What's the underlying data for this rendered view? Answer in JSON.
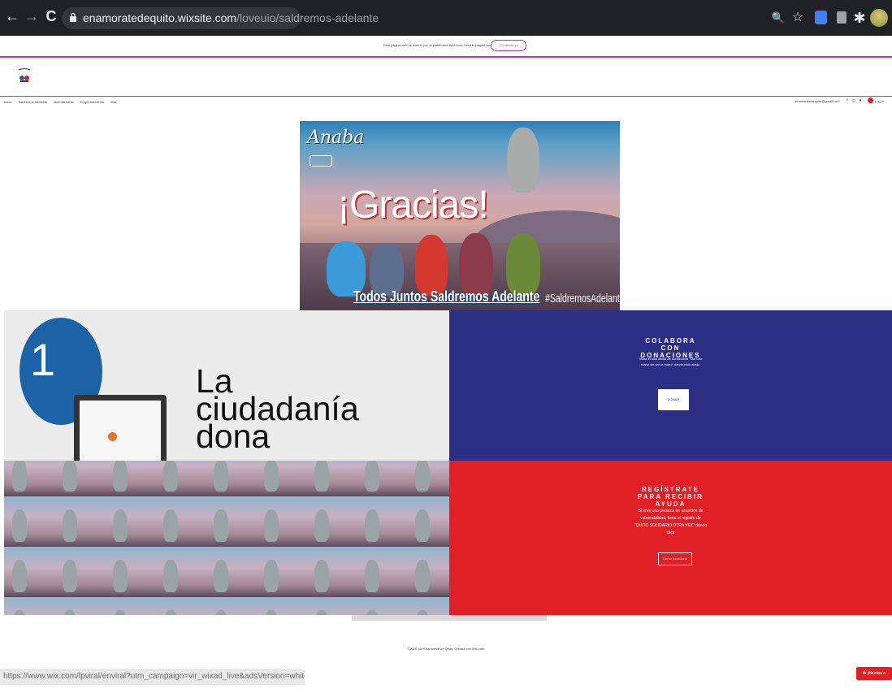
{
  "browser": {
    "url_domain": "enamoratedequito.wixsite.com",
    "url_path": "/loveuio/saldremos-adelante",
    "back_icon": "←",
    "forward_icon": "→",
    "reload_icon": "C",
    "zoom_icon": "🔍",
    "star_icon": "☆",
    "extensions_icon": "✱"
  },
  "wix_banner": {
    "text": "Esta página web se diseñó con la plataforma WIX.com. Crea tu página web hoy.",
    "cta": "Comienza ya"
  },
  "header": {
    "menu": [
      "Inicio",
      "Saldremos Adelante",
      "Buenas Ideas",
      "Emprendimiento",
      "Más"
    ],
    "email": "enamoratedequito@gmail.com",
    "login": "Log In"
  },
  "hero": {
    "brand": "Anaba",
    "title": "¡Gracias!",
    "slogan": "Todos Juntos Saldremos Adelante",
    "hashtag": "#SaldremosAdelante"
  },
  "dona_block": {
    "number": "1",
    "text": "La ciudadanía dona"
  },
  "colabora": {
    "title": "COLABORA CON DONACIONES",
    "description": "Visita el sitio oficial de donaciones \"Dar una mano sin dar la mano\" dando click abajo.",
    "button": "DONAR"
  },
  "registro": {
    "title": "REGÍSTRATE PARA RECIBIR AYUDA",
    "description": "Si eres una persona en situación de vulnerabilidad, llena el registro de \"QUITO SOLIDARIO OTRA VEZ\" dando click",
    "button": "Llenar formulario"
  },
  "footer": {
    "text": "©2020 por Enamórate de Quito. Creada con Wix.com"
  },
  "status_bar": {
    "url": "https://www.wix.com/lpviral/enviral?utm_campaign=vir_wixad_live&adsVersion=white&orig..."
  },
  "chat_button": {
    "label": "¡Hemos a chatear!"
  },
  "colors": {
    "navy": "#2b2e83",
    "red": "#e01f26",
    "wix_purple": "#b23ab2"
  }
}
